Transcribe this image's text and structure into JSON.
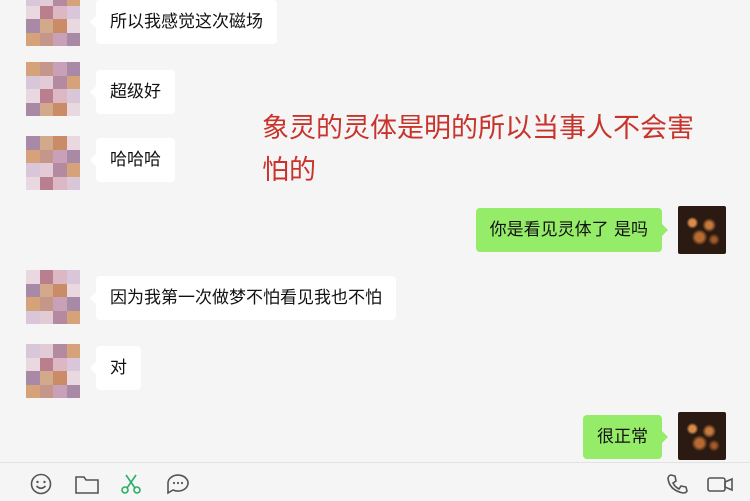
{
  "messages": [
    {
      "side": "left",
      "text": "所以我感觉这次磁场"
    },
    {
      "side": "left",
      "text": "超级好"
    },
    {
      "side": "left",
      "text": "哈哈哈"
    },
    {
      "side": "right",
      "text": "你是看见灵体了 是吗"
    },
    {
      "side": "left",
      "text": "因为我第一次做梦不怕看见我也不怕"
    },
    {
      "side": "left",
      "text": "对"
    },
    {
      "side": "right",
      "text": "很正常"
    }
  ],
  "annotation": {
    "line1": "象灵的灵体是明的所以当事人不会害",
    "line2": "怕的"
  },
  "colors": {
    "background": "#f5f5f5",
    "sent_bubble": "#95ec69",
    "received_bubble": "#ffffff",
    "annotation_text": "#c8342c"
  },
  "toolbar": {
    "icons": [
      "emoji-icon",
      "folder-icon",
      "scissors-icon",
      "chat-history-icon",
      "phone-icon",
      "video-icon"
    ]
  }
}
